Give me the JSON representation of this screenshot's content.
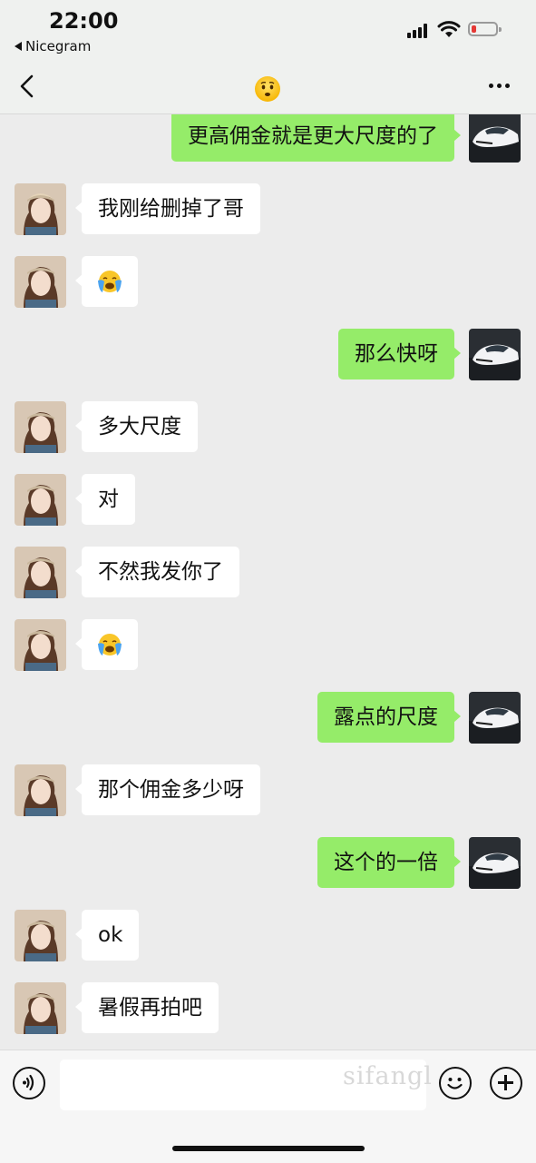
{
  "status_bar": {
    "time": "22:00",
    "back_app": "Nicegram",
    "battery_color": "#e53935"
  },
  "header": {
    "back_icon": "chevron-left-icon",
    "title_icon": "worried-face-emoji",
    "more_icon": "more-dots-icon"
  },
  "messages": [
    {
      "side": "out",
      "text": "更高佣金就是更大尺度的了"
    },
    {
      "side": "in",
      "text": "我刚给删掉了哥"
    },
    {
      "side": "in",
      "text": "",
      "emoji": "loudly-crying-face-emoji"
    },
    {
      "side": "out",
      "text": "那么快呀"
    },
    {
      "side": "in",
      "text": "多大尺度"
    },
    {
      "side": "in",
      "text": "对"
    },
    {
      "side": "in",
      "text": "不然我发你了"
    },
    {
      "side": "in",
      "text": "",
      "emoji": "loudly-crying-face-emoji"
    },
    {
      "side": "out",
      "text": "露点的尺度"
    },
    {
      "side": "in",
      "text": "那个佣金多少呀"
    },
    {
      "side": "out",
      "text": "这个的一倍"
    },
    {
      "side": "in",
      "text": "ok"
    },
    {
      "side": "in",
      "text": "暑假再拍吧"
    }
  ],
  "input_bar": {
    "voice_icon": "voice-input-icon",
    "text_value": "",
    "emoji_icon": "emoji-smile-icon",
    "plus_icon": "add-plus-icon",
    "watermark": "sifangl"
  },
  "colors": {
    "outgoing_bubble": "#95ec69",
    "incoming_bubble": "#ffffff",
    "chat_background": "#ececec"
  }
}
